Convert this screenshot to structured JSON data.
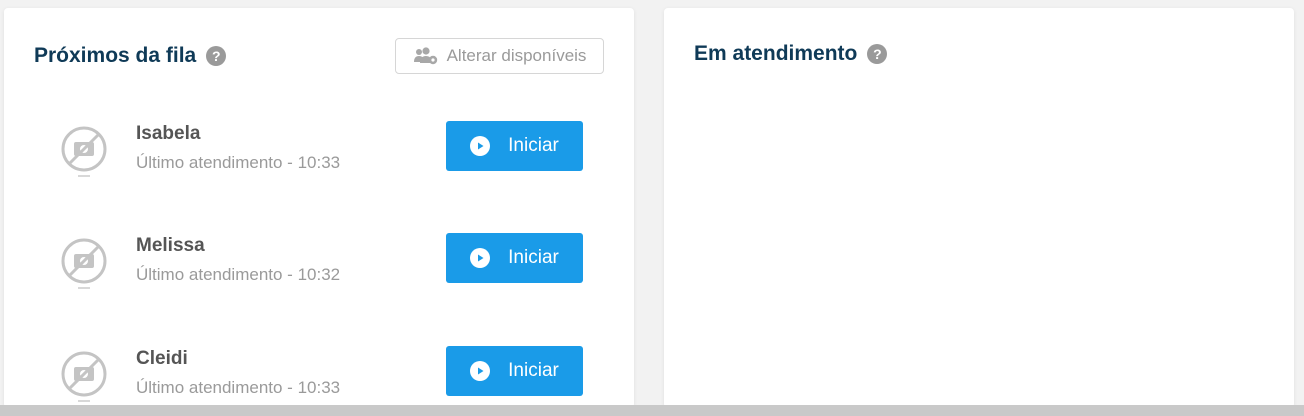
{
  "queue_panel": {
    "title": "Próximos da fila",
    "help_icon": "?",
    "alter_button_label": "Alterar disponíveis",
    "items": [
      {
        "name": "Isabela",
        "last_service": "Último atendimento - 10:33",
        "start_label": "Iniciar"
      },
      {
        "name": "Melissa",
        "last_service": "Último atendimento - 10:32",
        "start_label": "Iniciar"
      },
      {
        "name": "Cleidi",
        "last_service": "Último atendimento - 10:33",
        "start_label": "Iniciar"
      }
    ]
  },
  "service_panel": {
    "title": "Em atendimento",
    "help_icon": "?"
  },
  "colors": {
    "title": "#0f3a57",
    "primary_button": "#1a9be8",
    "muted_text": "#9a9a9a",
    "name_text": "#555555"
  },
  "icons": {
    "help": "question-circle-icon",
    "alter": "users-cog-icon",
    "avatar": "no-photo-avatar-icon",
    "start": "play-circle-icon"
  }
}
